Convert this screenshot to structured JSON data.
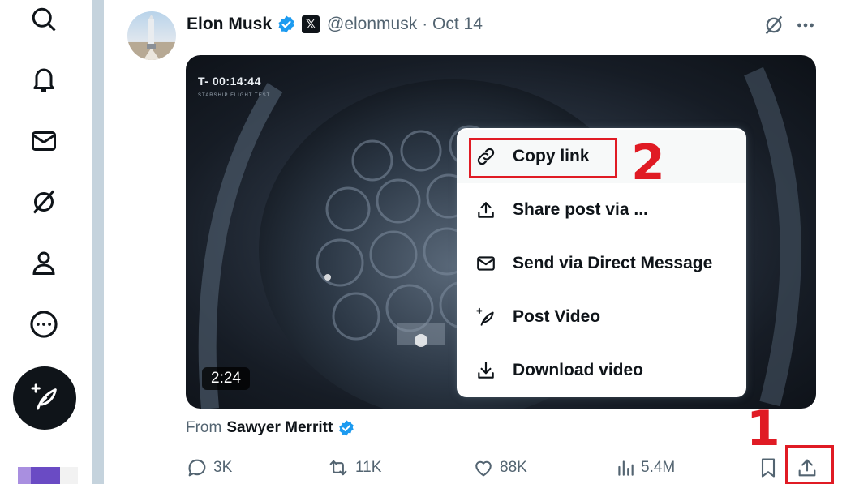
{
  "nav": {
    "items": [
      {
        "icon": "search-icon"
      },
      {
        "icon": "bell-icon"
      },
      {
        "icon": "mail-icon"
      },
      {
        "icon": "grok-icon"
      },
      {
        "icon": "profile-icon"
      },
      {
        "icon": "more-circle-icon"
      }
    ],
    "compose_icon": "compose-feather-icon"
  },
  "post": {
    "author_name": "Elon Musk",
    "handle": "@elonmusk",
    "date": "· Oct 14",
    "media": {
      "overlay_timer": "T- 00:14:44",
      "overlay_subtitle": "STARSHIP FLIGHT TEST",
      "duration": "2:24"
    },
    "from_prefix": "From",
    "from_source": "Sawyer Merritt",
    "stats": {
      "replies": "3K",
      "reposts": "11K",
      "likes": "88K",
      "views": "5.4M"
    }
  },
  "share_menu": {
    "items": [
      {
        "label": "Copy link",
        "icon": "link-icon"
      },
      {
        "label": "Share post via ...",
        "icon": "share-upload-icon"
      },
      {
        "label": "Send via Direct Message",
        "icon": "mail-icon"
      },
      {
        "label": "Post Video",
        "icon": "post-feather-icon"
      },
      {
        "label": "Download video",
        "icon": "download-icon"
      }
    ]
  },
  "annotations": {
    "step1": "1",
    "step2": "2",
    "color": "#e01b24"
  },
  "colors": {
    "verified": "#1d9bf0",
    "secondary_text": "#536471",
    "primary_text": "#0f1419"
  }
}
